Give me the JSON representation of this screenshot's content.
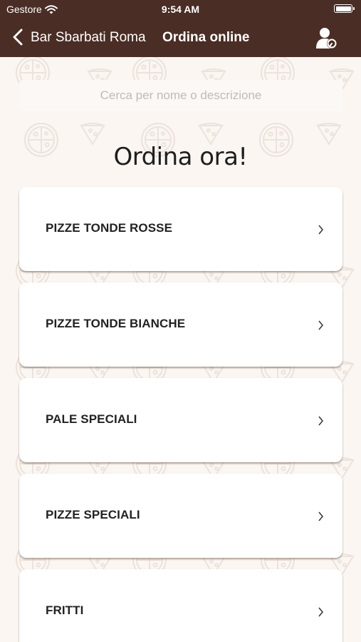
{
  "status_bar": {
    "carrier": "Gestore",
    "time": "9:54 AM"
  },
  "navbar": {
    "back_label": "Bar Sbarbati Roma",
    "title": "Ordina online"
  },
  "search": {
    "placeholder": "Cerca per nome o descrizione",
    "value": ""
  },
  "heading": "Ordina ora!",
  "categories": [
    {
      "label": "PIZZE TONDE ROSSE"
    },
    {
      "label": "PIZZE TONDE BIANCHE"
    },
    {
      "label": "PALE SPECIALI"
    },
    {
      "label": "PIZZE SPECIALI"
    },
    {
      "label": "FRITTI"
    }
  ],
  "colors": {
    "header": "#4a2d24",
    "background": "#fbf6f2",
    "card": "#ffffff"
  }
}
